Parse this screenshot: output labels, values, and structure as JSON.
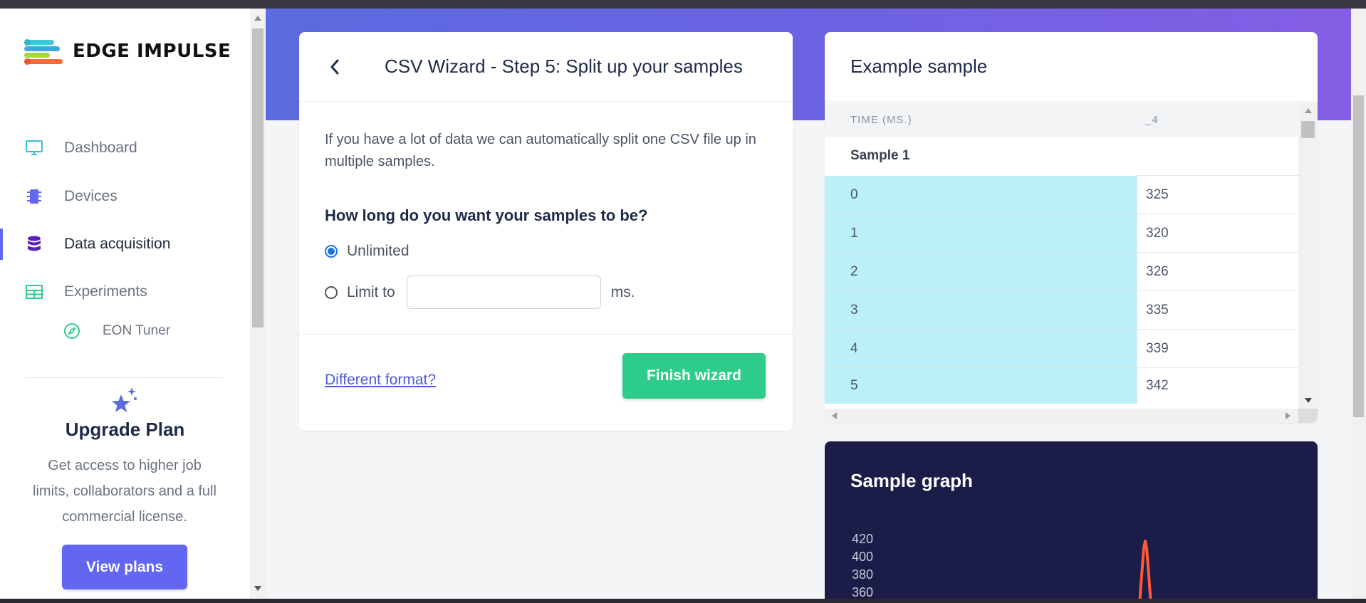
{
  "app": {
    "logo_text": "EDGE IMPULSE"
  },
  "sidebar": {
    "items": [
      {
        "label": "Dashboard",
        "icon": "monitor-icon"
      },
      {
        "label": "Devices",
        "icon": "chip-icon"
      },
      {
        "label": "Data acquisition",
        "icon": "database-icon"
      },
      {
        "label": "Experiments",
        "icon": "table-icon"
      },
      {
        "label": "EON Tuner",
        "icon": "compass-icon"
      }
    ],
    "upgrade": {
      "title": "Upgrade Plan",
      "text": "Get access to higher job limits, collaborators and a full commercial license.",
      "button": "View plans"
    }
  },
  "wizard": {
    "title": "CSV Wizard - Step 5: Split up your samples",
    "intro": "If you have a lot of data we can automatically split one CSV file up in multiple samples.",
    "question": "How long do you want your samples to be?",
    "options": {
      "unlimited": "Unlimited",
      "limit": "Limit to",
      "unit": "ms."
    },
    "selected": "unlimited",
    "limit_value": "",
    "different_format": "Different format?",
    "finish": "Finish wizard"
  },
  "example": {
    "title": "Example sample",
    "columns": [
      "TIME (MS.)",
      "_4"
    ],
    "group": "Sample 1",
    "rows": [
      [
        "0",
        "325"
      ],
      [
        "1",
        "320"
      ],
      [
        "2",
        "326"
      ],
      [
        "3",
        "335"
      ],
      [
        "4",
        "339"
      ],
      [
        "5",
        "342"
      ]
    ]
  },
  "graph": {
    "title": "Sample graph",
    "y_ticks": [
      "420",
      "400",
      "380",
      "360"
    ],
    "line_color": "#ff5a36"
  },
  "colors": {
    "accent": "#6366f1",
    "success": "#2ecc8a",
    "highlight_cell": "#bcf0f8",
    "graph_bg": "#1b1d48"
  }
}
